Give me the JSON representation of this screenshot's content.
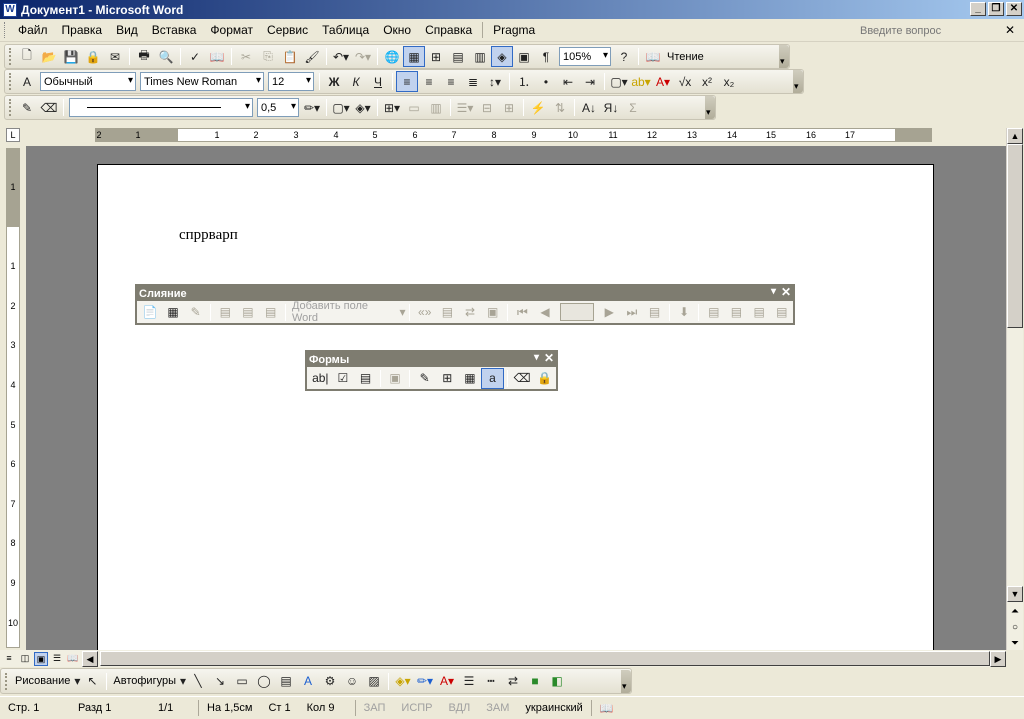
{
  "window": {
    "title": "Документ1 - Microsoft Word"
  },
  "menu": {
    "items": [
      "Файл",
      "Правка",
      "Вид",
      "Вставка",
      "Формат",
      "Сервис",
      "Таблица",
      "Окно",
      "Справка"
    ],
    "extra": "Pragma",
    "question_placeholder": "Введите вопрос"
  },
  "standard_toolbar": {
    "zoom": "105%",
    "read_label": "Чтение"
  },
  "format_toolbar": {
    "style": "Обычный",
    "font": "Times New Roman",
    "size": "12"
  },
  "tables_toolbar": {
    "line_weight": "0,5"
  },
  "ruler": {
    "h_ticks": [
      "2",
      "1",
      "1",
      "2",
      "3",
      "4",
      "5",
      "6",
      "7",
      "8",
      "9",
      "10",
      "11",
      "12",
      "13",
      "14",
      "15",
      "16",
      "17"
    ],
    "v_ticks": [
      "1",
      "1",
      "2",
      "3",
      "4",
      "5",
      "6",
      "7",
      "8",
      "9",
      "10"
    ]
  },
  "document": {
    "text": "спррварп"
  },
  "mailmerge_toolbar": {
    "title": "Слияние",
    "insert_field_label": "Добавить поле Word"
  },
  "forms_toolbar": {
    "title": "Формы"
  },
  "drawing_toolbar": {
    "drawing_label": "Рисование",
    "autoshapes_label": "Автофигуры"
  },
  "status": {
    "page": "Стр. 1",
    "section": "Разд 1",
    "pages": "1/1",
    "at": "На 1,5см",
    "line": "Ст 1",
    "col": "Кол 9",
    "rec": "ЗАП",
    "trk": "ИСПР",
    "ext": "ВДЛ",
    "ovr": "ЗАМ",
    "language": "украинский"
  }
}
